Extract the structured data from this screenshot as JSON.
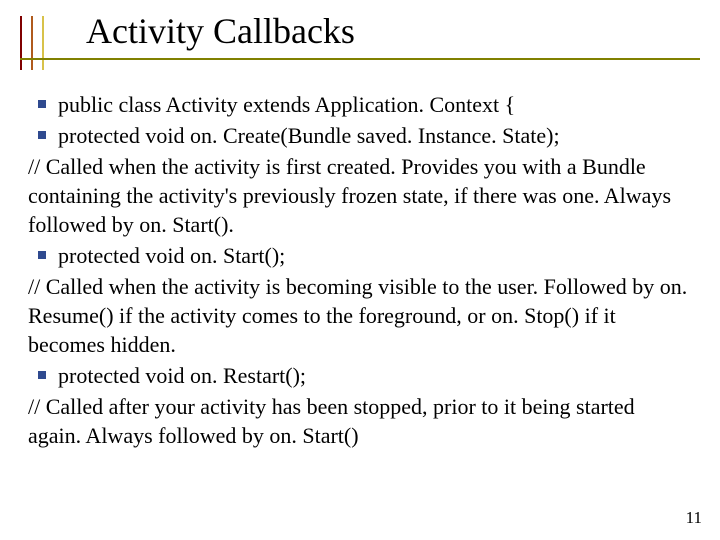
{
  "title": "Activity Callbacks",
  "bullets": {
    "b1": "public class Activity extends Application. Context {",
    "b2": "protected void on. Create(Bundle saved. Instance. State);",
    "c2": "// Called when the activity is first created. Provides you with a Bundle containing the activity's previously frozen state, if there was one. Always followed by on. Start().",
    "b3": "protected void on. Start();",
    "c3": "// Called when the activity is becoming visible to the user. Followed by on. Resume() if the activity comes to the foreground, or on. Stop() if it becomes hidden.",
    "b4": "protected void on. Restart();",
    "c4": "// Called after your activity has been stopped, prior to it being started again. Always followed by on. Start()"
  },
  "page_number": "11"
}
